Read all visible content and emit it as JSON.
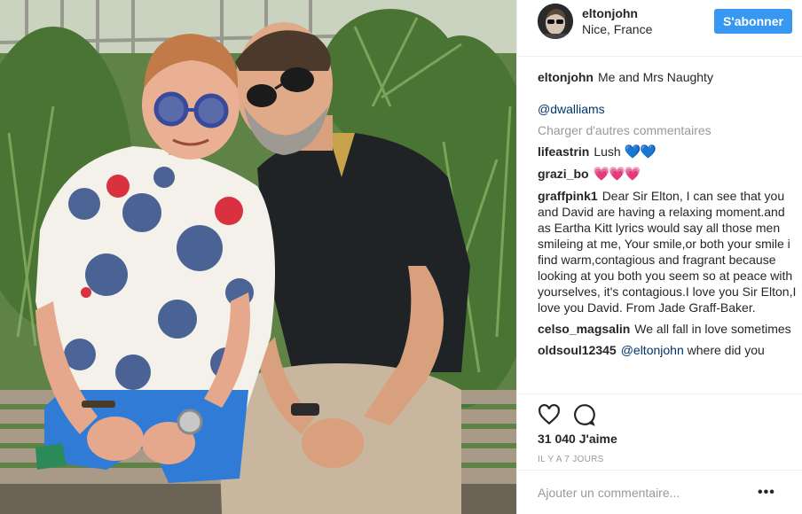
{
  "header": {
    "username": "eltonjohn",
    "location": "Nice, France",
    "follow_label": "S'abonner",
    "avatar_icon": "profile-avatar"
  },
  "caption": {
    "username": "eltonjohn",
    "text": "Me and Mrs Naughty",
    "mention": "@dwalliams"
  },
  "load_more": "Charger d'autres commentaires",
  "comments": [
    {
      "username": "lifeastrin",
      "text": "Lush ",
      "emoji": "💙💙",
      "emoji_color": "#3a8fe8"
    },
    {
      "username": "grazi_bo",
      "text": "",
      "emoji": "💗💗💗",
      "emoji_color": "#ff7bd6"
    },
    {
      "username": "graffpink1",
      "text": "Dear Sir Elton, I can see that you and David are having a relaxing moment.and as Eartha Kitt lyrics would say all those men smileing at me, Your smile,or both your smile i find warm,contagious and fragrant because looking at you both you seem so at peace with yourselves, it's contagious.I love you Sir Elton,I love you David. From Jade Graff-Baker."
    },
    {
      "username": "celso_magsalin",
      "text": "We all fall in love sometimes"
    },
    {
      "username": "oldsoul12345",
      "mention": "@eltonjohn",
      "text": " where did you"
    }
  ],
  "actions": {
    "like_icon": "heart-outline-icon",
    "comment_icon": "comment-bubble-icon",
    "likes": "31 040 J'aime",
    "timestamp": "IL Y A 7 JOURS"
  },
  "add_comment": {
    "placeholder": "Ajouter un commentaire...",
    "options_label": "•••"
  },
  "colors": {
    "accent": "#3897f0",
    "link": "#003569",
    "muted": "#999999",
    "divider": "#efefef"
  }
}
